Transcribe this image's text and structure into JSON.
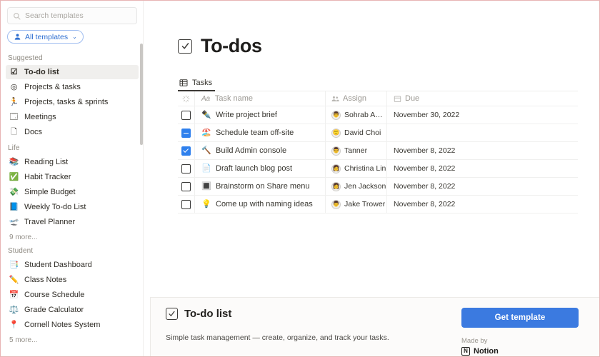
{
  "colors": {
    "accent_blue": "#2f80ed",
    "button_blue": "#3b7ae0",
    "chip_blue": "#2f6fd0",
    "border_pink": "#e8b4b4",
    "selected_bg": "#f0efed"
  },
  "sidebar": {
    "search": {
      "placeholder": "Search templates",
      "value": "",
      "icon": "search-icon"
    },
    "filter": {
      "label": "All templates",
      "icon": "person-icon",
      "caret": "⌄"
    },
    "sections": [
      {
        "title": "Suggested",
        "items": [
          {
            "label": "To-do list",
            "icon": "☑",
            "selected": true
          },
          {
            "label": "Projects & tasks",
            "icon": "◎",
            "selected": false
          },
          {
            "label": "Projects, tasks & sprints",
            "icon": "🏃",
            "selected": false
          },
          {
            "label": "Meetings",
            "icon": "🗔",
            "selected": false
          },
          {
            "label": "Docs",
            "icon": "🗋",
            "selected": false
          }
        ],
        "more": ""
      },
      {
        "title": "Life",
        "items": [
          {
            "label": "Reading List",
            "icon": "📚",
            "selected": false
          },
          {
            "label": "Habit Tracker",
            "icon": "✅",
            "selected": false
          },
          {
            "label": "Simple Budget",
            "icon": "💸",
            "selected": false
          },
          {
            "label": "Weekly To-do List",
            "icon": "📘",
            "selected": false
          },
          {
            "label": "Travel Planner",
            "icon": "🛫",
            "selected": false
          }
        ],
        "more": "9 more..."
      },
      {
        "title": "Student",
        "items": [
          {
            "label": "Student Dashboard",
            "icon": "📑",
            "selected": false
          },
          {
            "label": "Class Notes",
            "icon": "✏️",
            "selected": false
          },
          {
            "label": "Course Schedule",
            "icon": "📅",
            "selected": false
          },
          {
            "label": "Grade Calculator",
            "icon": "⚖️",
            "selected": false
          },
          {
            "label": "Cornell Notes System",
            "icon": "📍",
            "selected": false
          }
        ],
        "more": "5 more..."
      }
    ]
  },
  "main": {
    "page_title": "To-dos",
    "page_icon": "checkbox-icon",
    "tabs": [
      {
        "label": "Tasks",
        "icon": "table-icon",
        "active": true
      }
    ],
    "table": {
      "headers": {
        "check": "",
        "name": "Task name",
        "name_prefix": "Aa",
        "assign": "Assign",
        "due": "Due"
      },
      "rows": [
        {
          "checked": "unchecked",
          "emoji": "✒️",
          "name": "Write project brief",
          "assignee": "Sohrab Amin",
          "avatar": "👨",
          "due": "November 30, 2022"
        },
        {
          "checked": "indeterminate",
          "emoji": "🏖️",
          "name": "Schedule team off-site",
          "assignee": "David Choi",
          "avatar": "🙂",
          "due": ""
        },
        {
          "checked": "checked",
          "emoji": "🔨",
          "name": "Build Admin console",
          "assignee": "Tanner",
          "avatar": "👨",
          "due": "November 8, 2022"
        },
        {
          "checked": "unchecked",
          "emoji": "📄",
          "name": "Draft launch blog post",
          "assignee": "Christina Lin",
          "avatar": "👩",
          "due": "November 8, 2022"
        },
        {
          "checked": "unchecked",
          "emoji": "🔳",
          "name": "Brainstorm on Share menu",
          "assignee": "Jen Jackson",
          "avatar": "👩",
          "due": "November 8, 2022"
        },
        {
          "checked": "unchecked",
          "emoji": "💡",
          "name": "Come up with naming ideas",
          "assignee": "Jake Trower",
          "avatar": "👨",
          "due": "November 8, 2022"
        }
      ]
    }
  },
  "bottom_card": {
    "title": "To-do list",
    "icon": "checkbox-icon",
    "description": "Simple task management — create, organize, and track your tasks.",
    "cta_label": "Get template",
    "made_by_label": "Made by",
    "maker_name": "Notion",
    "maker_logo": "N"
  }
}
